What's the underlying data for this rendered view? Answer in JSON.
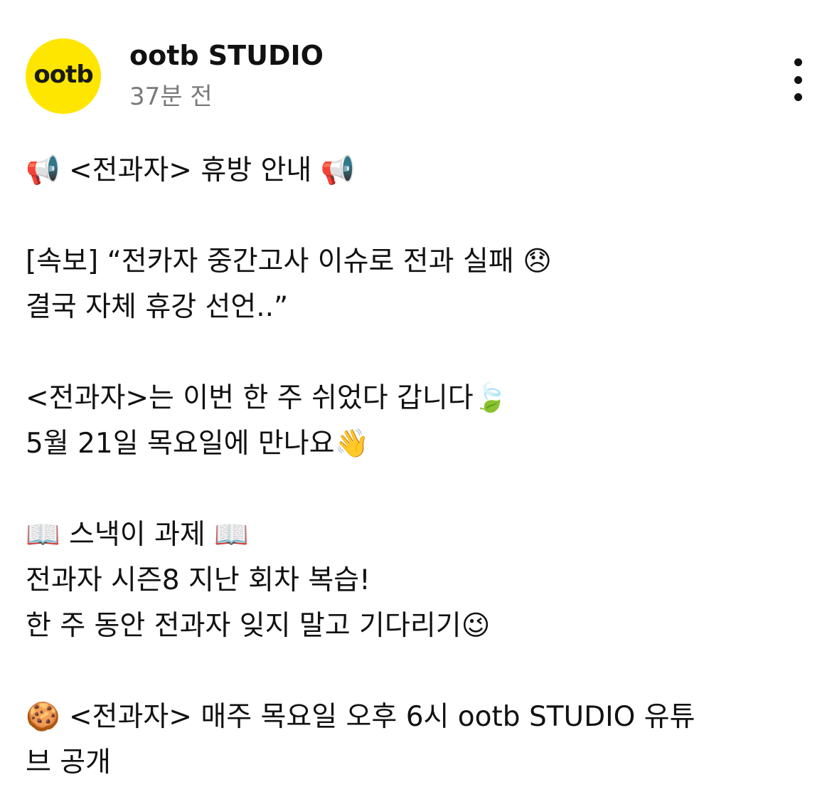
{
  "post": {
    "avatar_text": "ootb",
    "author": "ootb STUDIO",
    "time": "37분 전",
    "more_icon": "more-vertical-icon"
  },
  "content": {
    "lines": [
      "📢 <전과자> 휴방 안내 📢",
      "",
      "[속보] “전카자 중간고사 이슈로 전과 실패 😞",
      "결국 자체 휴강 선언..”",
      "",
      "<전과자>는 이번 한 주 쉬었다 갑니다🍃",
      "5월 21일 목요일에 만나요👋",
      "",
      "📖 스낵이 과제 📖",
      "전과자 시즌8 지난 회차 복습!",
      "한 주 동안 전과자 잊지 말고 기다리기😉",
      "",
      "🍪 <전과자> 매주 목요일 오후 6시 ootb STUDIO 유튜",
      "브 공개"
    ]
  },
  "colors": {
    "avatar_bg": "#FFE600",
    "text": "#111111",
    "muted": "#7a7a7a"
  }
}
